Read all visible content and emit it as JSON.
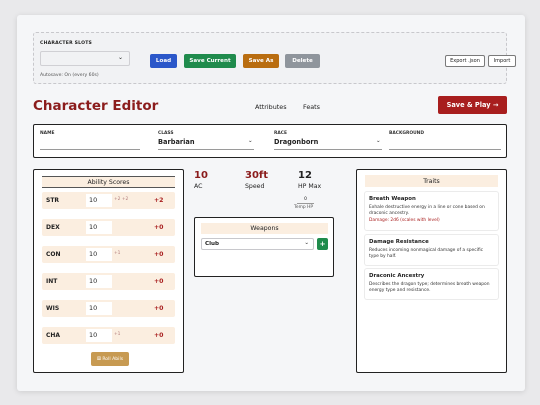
{
  "slots": {
    "title": "CHARACTER SLOTS",
    "selected": "",
    "load": "Load",
    "save_current": "Save Current",
    "save_as": "Save As",
    "delete": "Delete",
    "export": "Export .json",
    "import": "Import",
    "autosave": "Autosave: On (every 60s)"
  },
  "header": {
    "title": "Character Editor",
    "nav": [
      "Attributes",
      "Feats"
    ],
    "save_play": "Save & Play →"
  },
  "info": {
    "name_label": "NAME",
    "name_value": "",
    "class_label": "CLASS",
    "class_value": "Barbarian",
    "race_label": "RACE",
    "race_value": "Dragonborn",
    "background_label": "BACKGROUND",
    "background_value": ""
  },
  "abilities": {
    "title": "Ability Scores",
    "rows": [
      {
        "name": "STR",
        "score": "10",
        "bonus": "+2  +2",
        "mod": "+2"
      },
      {
        "name": "DEX",
        "score": "10",
        "bonus": "",
        "mod": "+0"
      },
      {
        "name": "CON",
        "score": "10",
        "bonus": "+1",
        "mod": "+0"
      },
      {
        "name": "INT",
        "score": "10",
        "bonus": "",
        "mod": "+0"
      },
      {
        "name": "WIS",
        "score": "10",
        "bonus": "",
        "mod": "+0"
      },
      {
        "name": "CHA",
        "score": "10",
        "bonus": "+1",
        "mod": "+0"
      }
    ],
    "roll": "Roll Abils"
  },
  "stats": {
    "ac_value": "10",
    "ac_label": "AC",
    "speed_value": "30ft",
    "speed_label": "Speed",
    "hp_value": "12",
    "hp_label": "HP Max",
    "temp_value": "0",
    "temp_label": "Temp HP"
  },
  "weapons": {
    "title": "Weapons",
    "selected": "Club",
    "add": "+"
  },
  "traits": {
    "title": "Traits",
    "items": [
      {
        "name": "Breath Weapon",
        "desc": "Exhale destructive energy in a line or cone based on draconic ancestry.",
        "damage": "Damage: 2d6 (scales with level)"
      },
      {
        "name": "Damage Resistance",
        "desc": "Reduces incoming nonmagical damage of a specific type by half.",
        "damage": ""
      },
      {
        "name": "Draconic Ancestry",
        "desc": "Describes the dragon type; determines breath weapon energy type and resistance.",
        "damage": ""
      }
    ]
  },
  "colors": {
    "accent": "#a81e1e",
    "title": "#8b1c1c",
    "load": "#2b57c9",
    "save": "#1f8b4c",
    "saveas": "#b96d10",
    "delete": "#8f959c"
  }
}
